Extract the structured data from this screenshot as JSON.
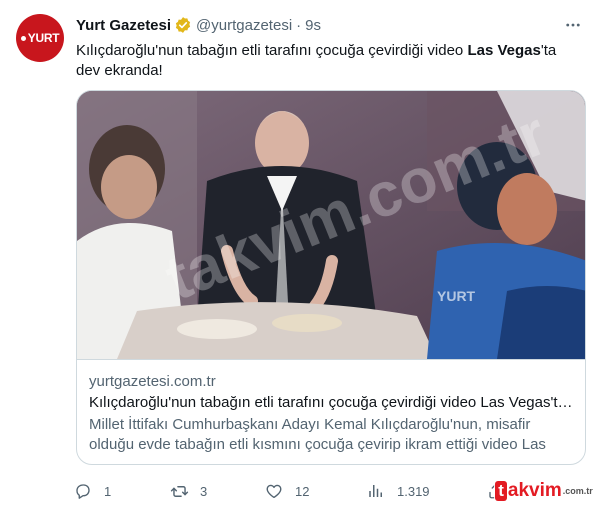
{
  "account": {
    "logo_text": "YURT",
    "name": "Yurt Gazetesi",
    "handle": "@yurtgazetesi",
    "separator": "·",
    "time": "9s"
  },
  "tweet": {
    "text_part1": "Kılıçdaroğlu'nun tabağın etli tarafını çocuğa çevirdiği video ",
    "text_bold": "Las Vegas",
    "text_part2": "'ta dev ekranda!"
  },
  "card": {
    "media_watermark": "takvim.com.tr",
    "domain": "yurtgazetesi.com.tr",
    "title": "Kılıçdaroğlu'nun tabağın etli tarafını çocuğa çevirdiği video Las Vegas'ta dev ekranda!",
    "description": "Millet İttifakı Cumhurbaşkanı Adayı Kemal Kılıçdaroğlu'nun, misafir olduğu evde tabağın etli kısmını çocuğa çevirip ikram ettiği video Las Vegas'ta dev ekranda!"
  },
  "actions": {
    "reply_count": "1",
    "retweet_count": "3",
    "like_count": "12",
    "views_count": "1.319"
  },
  "watermark": {
    "first_letter": "t",
    "rest": "akvim",
    "suffix": ".com.tr"
  },
  "colors": {
    "text_primary": "#0f1419",
    "text_secondary": "#536471",
    "border": "#cfd9de",
    "verified": "#e2b719",
    "brand_red": "#c8161d"
  },
  "icons": [
    "yurt-logo",
    "verified-badge-icon",
    "more-icon",
    "reply-icon",
    "retweet-icon",
    "like-icon",
    "views-icon",
    "share-icon"
  ]
}
